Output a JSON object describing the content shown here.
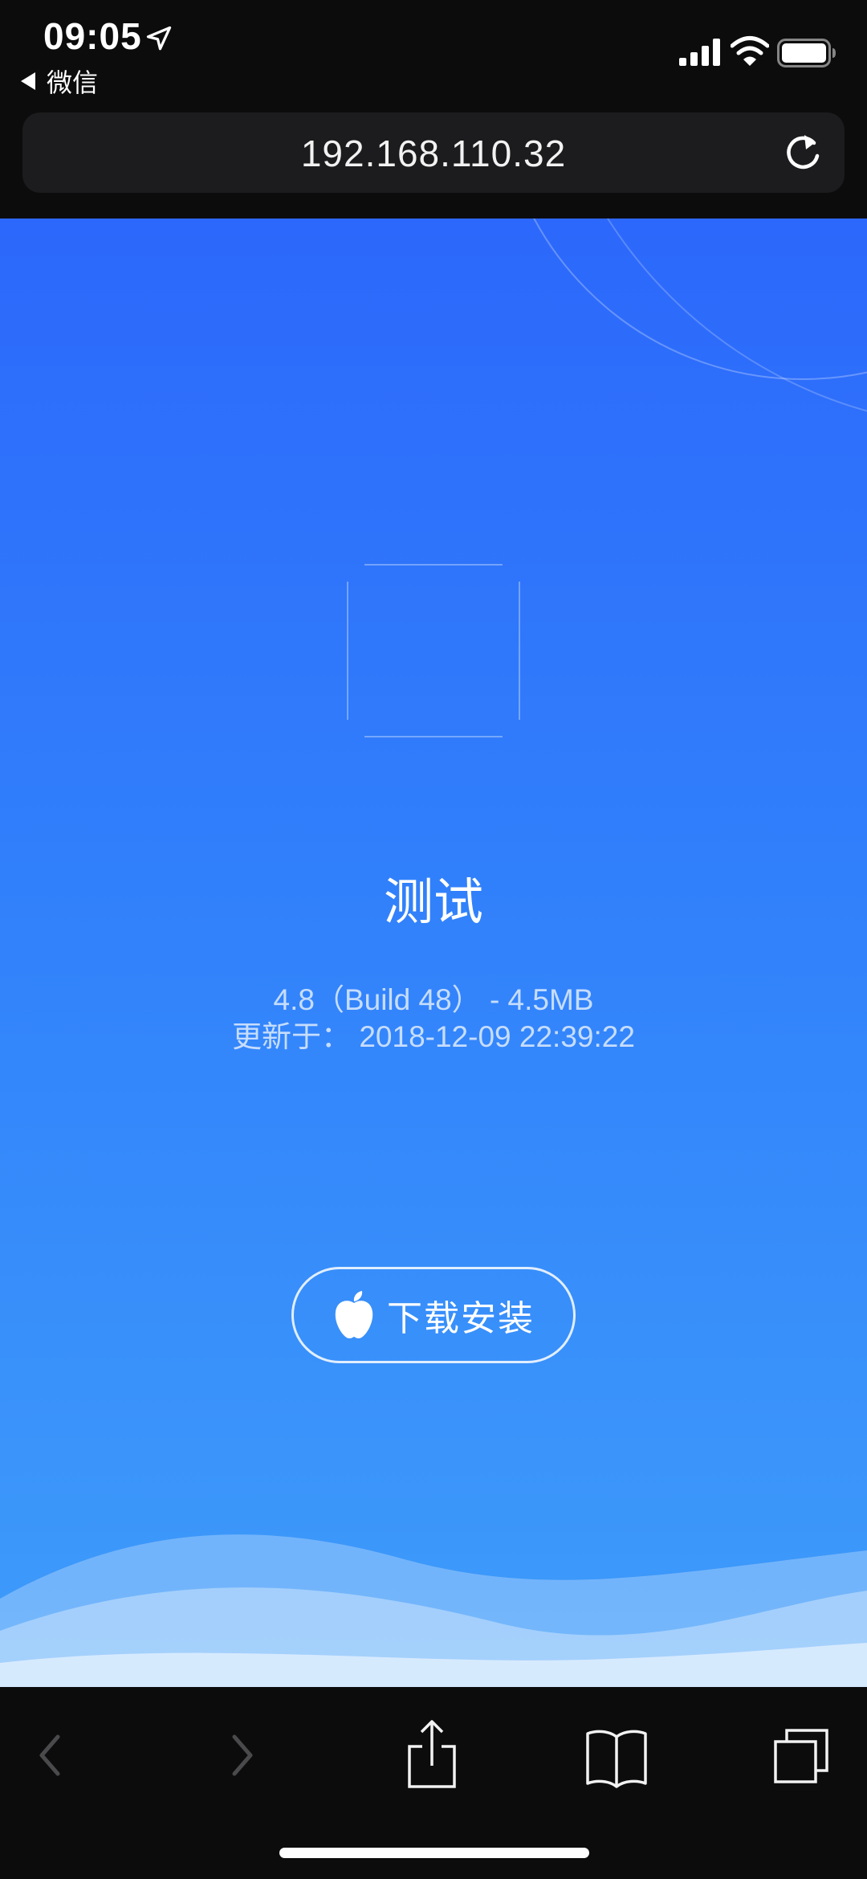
{
  "status_bar": {
    "time": "09:05",
    "back_app": "微信",
    "icons": [
      "location-arrow-icon",
      "signal-icon",
      "wifi-icon",
      "battery-icon"
    ]
  },
  "browser": {
    "url": "192.168.110.32",
    "reload_icon": "reload-icon"
  },
  "app": {
    "name": "测试",
    "version_line": "4.8（Build 48） - 4.5MB",
    "updated_line": "更新于： 2018-12-09 22:39:22",
    "install_label": "下载安装",
    "install_icon": "apple-icon"
  },
  "toolbar": {
    "items": [
      "back-icon",
      "forward-icon",
      "share-icon",
      "bookmarks-icon",
      "tabs-icon"
    ]
  },
  "colors": {
    "gradient_top": "#2c68fb",
    "gradient_bottom": "#3e9cfa",
    "chrome_bg": "#0c0c0d",
    "url_bar_bg": "#1c1c1e"
  }
}
